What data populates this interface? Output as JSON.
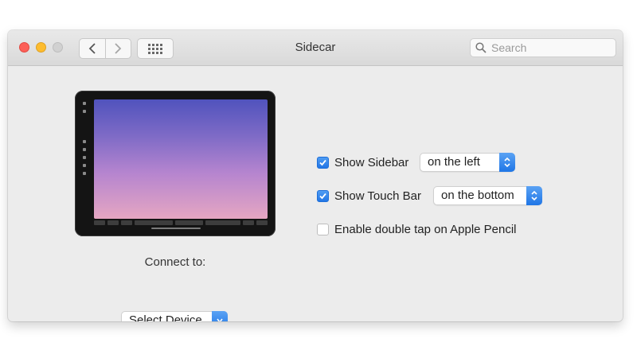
{
  "window": {
    "title": "Sidecar"
  },
  "toolbar": {
    "back_icon": "chevron-left-icon",
    "forward_icon": "chevron-right-icon",
    "show_all_icon": "grid-icon"
  },
  "search": {
    "placeholder": "Search",
    "value": ""
  },
  "options": {
    "show_sidebar": {
      "label": "Show Sidebar",
      "checked": true,
      "selected": "on the left"
    },
    "show_touch_bar": {
      "label": "Show Touch Bar",
      "checked": true,
      "selected": "on the bottom"
    },
    "double_tap": {
      "label": "Enable double tap on Apple Pencil",
      "checked": false
    }
  },
  "connect": {
    "label": "Connect to:",
    "selected": "Select Device"
  },
  "colors": {
    "accent": "#2276e6",
    "close": "#fc5f57",
    "minimize": "#fdbc2e",
    "inactive": "#d1d1d1"
  }
}
